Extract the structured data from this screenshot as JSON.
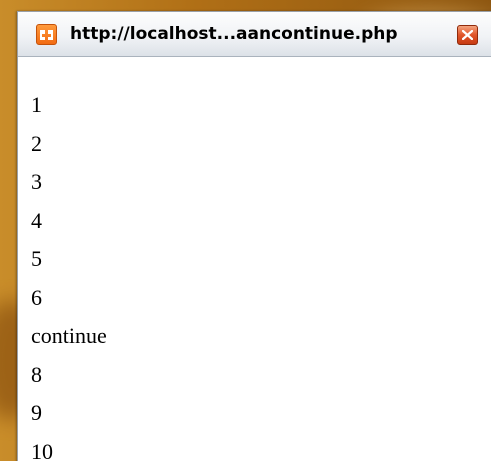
{
  "window": {
    "title": "http://localhost...aancontinue.php",
    "icon": "xampp-app-icon",
    "close_icon": "close-icon"
  },
  "output": {
    "lines": [
      "1",
      "2",
      "3",
      "4",
      "5",
      "6",
      "continue",
      "8",
      "9",
      "10"
    ]
  },
  "colors": {
    "titlebar": "#eef1f5",
    "close_button": "#e0552a",
    "app_icon": "#f26b12",
    "background": "#b06f16"
  }
}
